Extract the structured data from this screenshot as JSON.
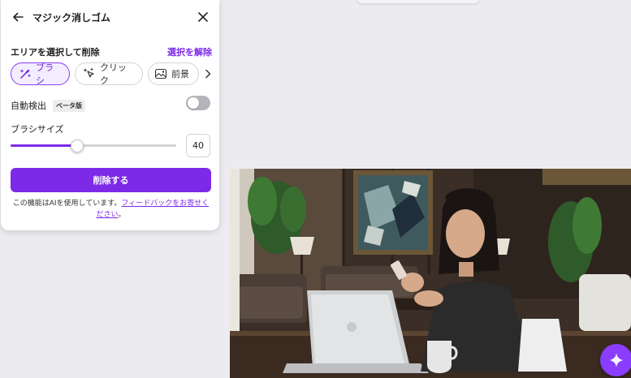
{
  "panel": {
    "title": "マジック消しゴム",
    "section_label": "エリアを選択して削除",
    "clear_selection": "選択を解除",
    "modes": [
      {
        "label": "ブラシ",
        "icon": "magic-brush-icon",
        "selected": true
      },
      {
        "label": "クリック",
        "icon": "magic-click-icon",
        "selected": false
      },
      {
        "label": "前景",
        "icon": "image-foreground-icon",
        "selected": false
      }
    ],
    "auto_detect": {
      "label": "自動検出",
      "badge": "ベータ版",
      "enabled": false
    },
    "brush_size": {
      "label": "ブラシサイズ",
      "value": "40",
      "level": 0.4
    },
    "erase_button": "削除する",
    "notice": {
      "text": "この機能はAIを使用しています。",
      "link": "フィードバックをお寄せください",
      "suffix": "。"
    }
  },
  "colors": {
    "accent": "#7d2ae8",
    "accent_light": "#f3edff"
  },
  "canvas": {
    "image": "photo-woman-laptop-phone",
    "fab_icon": "sparkle-icon"
  }
}
